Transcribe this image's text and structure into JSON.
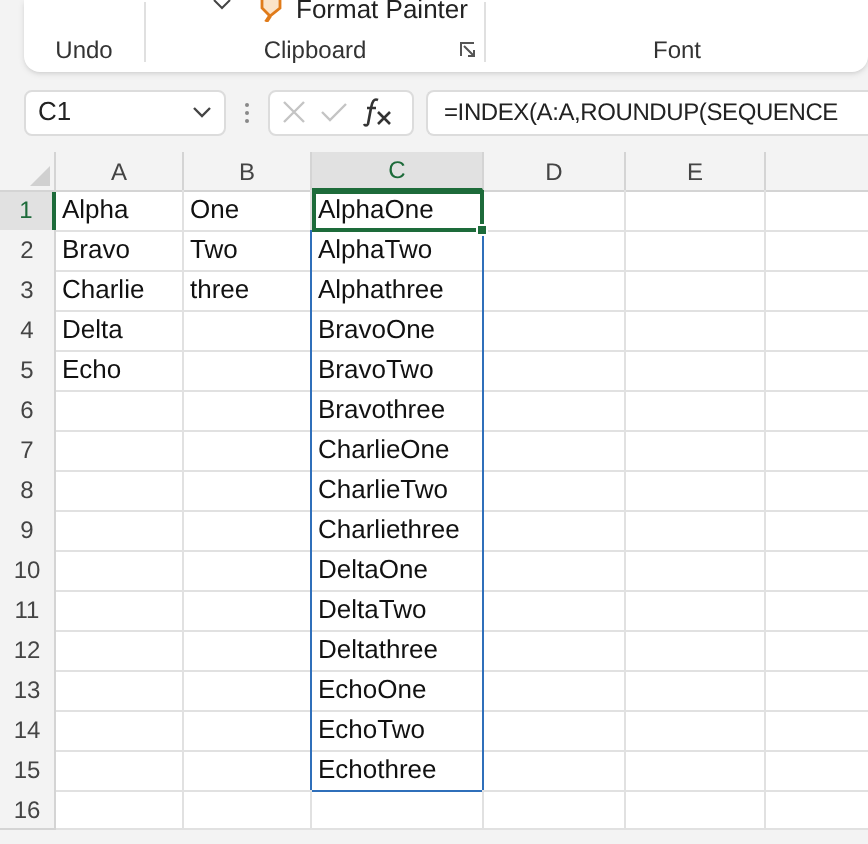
{
  "ribbon": {
    "top_items": [
      {
        "label": "Format Painter"
      }
    ],
    "groups": [
      {
        "label": "Undo",
        "launcher": false
      },
      {
        "label": "Clipboard",
        "launcher": true
      },
      {
        "label": "Font",
        "launcher": false
      }
    ]
  },
  "name_box": {
    "value": "C1"
  },
  "formula_bar": {
    "value": "=INDEX(A:A,ROUNDUP(SEQUENCE"
  },
  "columns": [
    {
      "label": "A",
      "selected": false
    },
    {
      "label": "B",
      "selected": false
    },
    {
      "label": "C",
      "selected": true
    },
    {
      "label": "D",
      "selected": false
    },
    {
      "label": "E",
      "selected": false
    }
  ],
  "rows": [
    {
      "label": "1",
      "selected": true,
      "cells": [
        {
          "text": "Alpha"
        },
        {
          "text": "One"
        },
        {
          "text": "AlphaOne",
          "active": true
        },
        {},
        {}
      ]
    },
    {
      "label": "2",
      "selected": false,
      "cells": [
        {
          "text": "Bravo"
        },
        {
          "text": "Two"
        },
        {
          "text": "AlphaTwo",
          "selected": true,
          "active": false
        },
        {},
        {}
      ]
    },
    {
      "label": "3",
      "selected": false,
      "cells": [
        {
          "text": "Charlie"
        },
        {
          "text": "three"
        },
        {
          "text": "Alphathree",
          "selected": true,
          "active": false
        },
        {},
        {}
      ]
    },
    {
      "label": "4",
      "selected": false,
      "cells": [
        {
          "text": "Delta"
        },
        {},
        {
          "text": "BravoOne",
          "selected": true,
          "active": false
        },
        {},
        {}
      ]
    },
    {
      "label": "5",
      "selected": false,
      "cells": [
        {
          "text": "Echo"
        },
        {},
        {
          "text": "BravoTwo",
          "selected": true,
          "active": false
        },
        {},
        {}
      ]
    },
    {
      "label": "6",
      "selected": false,
      "cells": [
        {},
        {},
        {
          "text": "Bravothree",
          "selected": true,
          "active": false
        },
        {},
        {}
      ]
    },
    {
      "label": "7",
      "selected": false,
      "cells": [
        {},
        {},
        {
          "text": "CharlieOne",
          "selected": true,
          "active": false
        },
        {},
        {}
      ]
    },
    {
      "label": "8",
      "selected": false,
      "cells": [
        {},
        {},
        {
          "text": "CharlieTwo",
          "selected": true,
          "active": false
        },
        {},
        {}
      ]
    },
    {
      "label": "9",
      "selected": false,
      "cells": [
        {},
        {},
        {
          "text": "Charliethree",
          "selected": true,
          "active": false
        },
        {},
        {}
      ]
    },
    {
      "label": "10",
      "selected": false,
      "cells": [
        {},
        {},
        {
          "text": "DeltaOne",
          "selected": true,
          "active": false
        },
        {},
        {}
      ]
    },
    {
      "label": "11",
      "selected": false,
      "cells": [
        {},
        {},
        {
          "text": "DeltaTwo",
          "selected": true,
          "active": false
        },
        {},
        {}
      ]
    },
    {
      "label": "12",
      "selected": false,
      "cells": [
        {},
        {},
        {
          "text": "Deltathree",
          "selected": true,
          "active": false
        },
        {},
        {}
      ]
    },
    {
      "label": "13",
      "selected": false,
      "cells": [
        {},
        {},
        {
          "text": "EchoOne",
          "selected": true,
          "active": false
        },
        {},
        {}
      ]
    },
    {
      "label": "14",
      "selected": false,
      "cells": [
        {},
        {},
        {
          "text": "EchoTwo",
          "selected": true,
          "active": false
        },
        {},
        {}
      ]
    },
    {
      "label": "15",
      "selected": false,
      "cells": [
        {},
        {},
        {
          "text": "Echothree",
          "selected": true,
          "active": false
        },
        {},
        {}
      ]
    },
    {
      "label": "16",
      "selected": false,
      "cells": [
        {},
        {},
        {},
        {},
        {}
      ]
    }
  ]
}
